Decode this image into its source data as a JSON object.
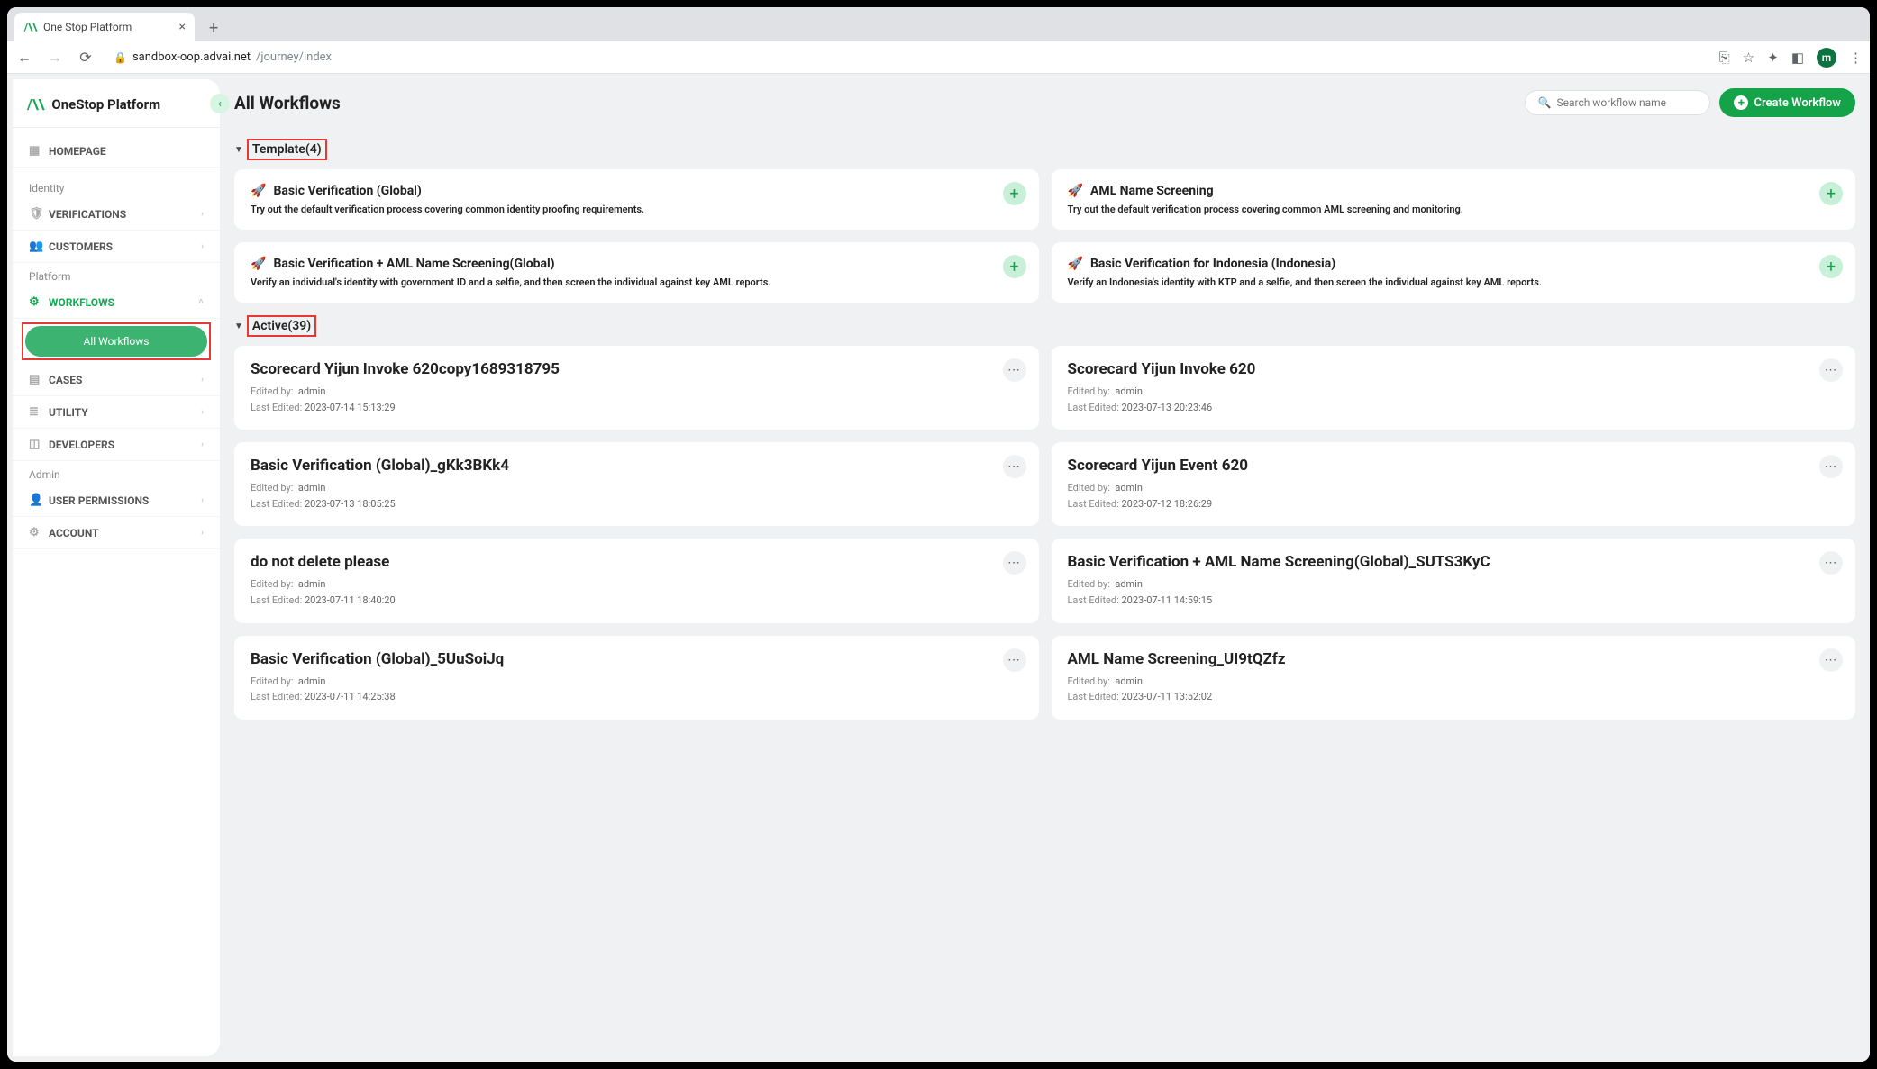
{
  "browser": {
    "tab_title": "One Stop Platform",
    "url_domain": "sandbox-oop.advai.net",
    "url_path": "/journey/index",
    "avatar_letter": "m"
  },
  "sidebar": {
    "brand": "OneStop Platform",
    "nav": {
      "homepage": "HOMEPAGE",
      "identity_label": "Identity",
      "verifications": "VERIFICATIONS",
      "customers": "CUSTOMERS",
      "platform_label": "Platform",
      "workflows": "WORKFLOWS",
      "all_workflows": "All Workflows",
      "cases": "CASES",
      "utility": "UTILITY",
      "developers": "DEVELOPERS",
      "admin_label": "Admin",
      "user_permissions": "USER PERMISSIONS",
      "account": "ACCOUNT"
    }
  },
  "main": {
    "title": "All Workflows",
    "search_placeholder": "Search workflow name",
    "create_label": "Create Workflow",
    "template_header": "Template(4)",
    "active_header": "Active(39)",
    "templates": [
      {
        "title": "Basic Verification (Global)",
        "desc": "Try out the default verification process covering common identity proofing requirements."
      },
      {
        "title": "AML Name Screening",
        "desc": "Try out the default verification process covering common AML screening and monitoring."
      },
      {
        "title": "Basic Verification + AML Name Screening(Global)",
        "desc": "Verify an individual's identity with government ID and a selfie, and then screen the individual against key AML reports."
      },
      {
        "title": "Basic Verification for Indonesia (Indonesia)",
        "desc": "Verify an Indonesia's identity with KTP and a selfie, and then screen the individual against key AML reports."
      }
    ],
    "workflows": [
      {
        "title": "Scorecard Yijun Invoke 620copy1689318795",
        "edited_by": "admin",
        "last_edited": "2023-07-14 15:13:29"
      },
      {
        "title": "Scorecard Yijun Invoke 620",
        "edited_by": "admin",
        "last_edited": "2023-07-13 20:23:46"
      },
      {
        "title": "Basic Verification (Global)_gKk3BKk4",
        "edited_by": "admin",
        "last_edited": "2023-07-13 18:05:25"
      },
      {
        "title": "Scorecard Yijun Event 620",
        "edited_by": "admin",
        "last_edited": "2023-07-12 18:26:29"
      },
      {
        "title": "do not delete please",
        "edited_by": "admin",
        "last_edited": "2023-07-11 18:40:20"
      },
      {
        "title": "Basic Verification + AML Name Screening(Global)_SUTS3KyC",
        "edited_by": "admin",
        "last_edited": "2023-07-11 14:59:15"
      },
      {
        "title": "Basic Verification (Global)_5UuSoiJq",
        "edited_by": "admin",
        "last_edited": "2023-07-11 14:25:38"
      },
      {
        "title": "AML Name Screening_UI9tQZfz",
        "edited_by": "admin",
        "last_edited": "2023-07-11 13:52:02"
      }
    ],
    "labels": {
      "edited_by": "Edited by:",
      "last_edited": "Last Edited:"
    }
  }
}
